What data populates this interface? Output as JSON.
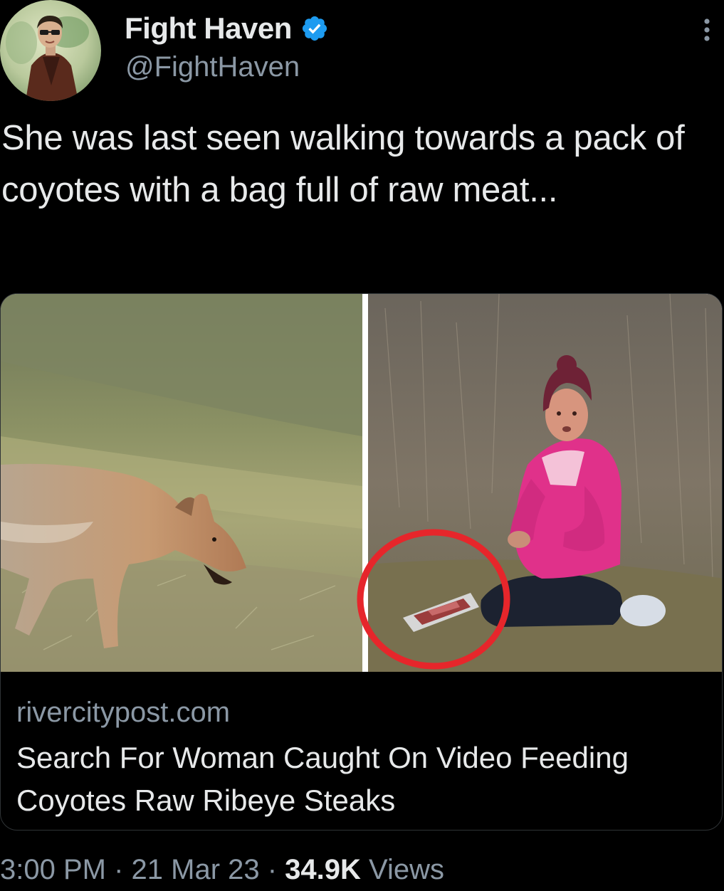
{
  "author": {
    "display_name": "Fight Haven",
    "handle": "@FightHaven",
    "verified_icon": "verified-badge-icon",
    "avatar_icon": "avatar-image"
  },
  "tweet": {
    "text": "She was last seen walking towards a pack of coyotes with a bag full of raw meat..."
  },
  "card": {
    "domain": "rivercitypost.com",
    "title": "Search For Woman Caught On Video Feeding Coyotes Raw Ribeye Steaks"
  },
  "meta": {
    "time": "3:00 PM",
    "sep1": " · ",
    "date": "21 Mar 23",
    "sep2": " · ",
    "views_count": "34.9K",
    "views_label": " Views"
  },
  "colors": {
    "background": "#000000",
    "text_primary": "#e7e9ea",
    "text_secondary": "#8b98a5",
    "verified_blue": "#1d9bf0",
    "annotation_red": "#e6262b",
    "jacket_pink": "#e0318a"
  }
}
